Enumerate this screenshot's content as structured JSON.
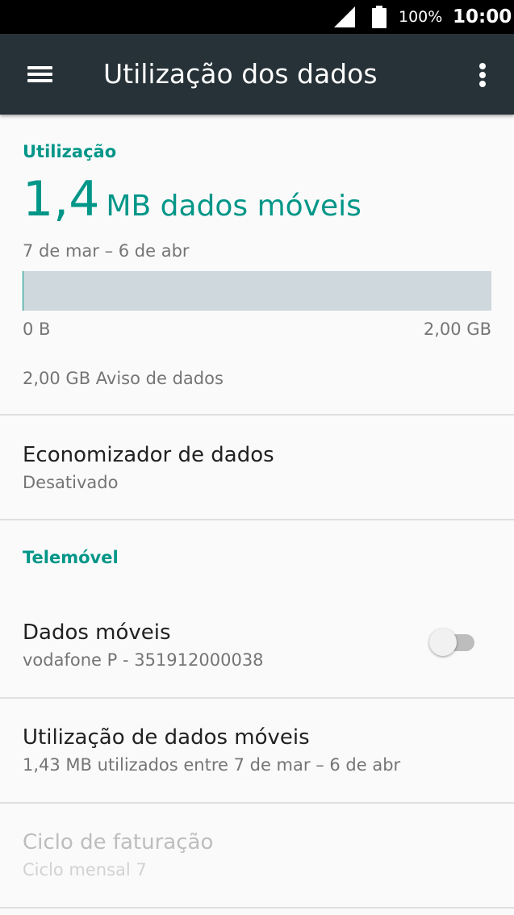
{
  "status_bar": {
    "battery_percent": "100%",
    "time": "10:00",
    "icons": [
      "cell-signal-icon",
      "battery-full-icon"
    ]
  },
  "app_bar": {
    "title": "Utilização dos dados",
    "icons": [
      "hamburger-menu-icon",
      "more-vert-icon"
    ]
  },
  "usage": {
    "section_label": "Utilização",
    "amount": "1,4",
    "unit_label": "MB dados móveis",
    "period": "7 de mar – 6 de abr",
    "bar_min_label": "0 B",
    "bar_max_label": "2,00 GB",
    "bar_fill_fraction": 0.0007,
    "warning": "2,00 GB Aviso de dados"
  },
  "data_saver": {
    "title": "Economizador de dados",
    "summary": "Desativado"
  },
  "mobile_section": {
    "label": "Telemóvel"
  },
  "mobile_data": {
    "title": "Dados móveis",
    "summary": "vodafone P - 351912000038",
    "enabled": false
  },
  "mobile_data_usage": {
    "title": "Utilização de dados móveis",
    "summary": "1,43 MB utilizados entre 7 de mar – 6 de abr"
  },
  "billing_cycle": {
    "title": "Ciclo de faturação",
    "summary": "Ciclo mensal 7",
    "enabled": false
  },
  "colors": {
    "accent": "#009688",
    "app_bar": "#263238",
    "status_bar": "#000000",
    "background": "#fafafa",
    "bar_track": "#cfd8dc"
  }
}
